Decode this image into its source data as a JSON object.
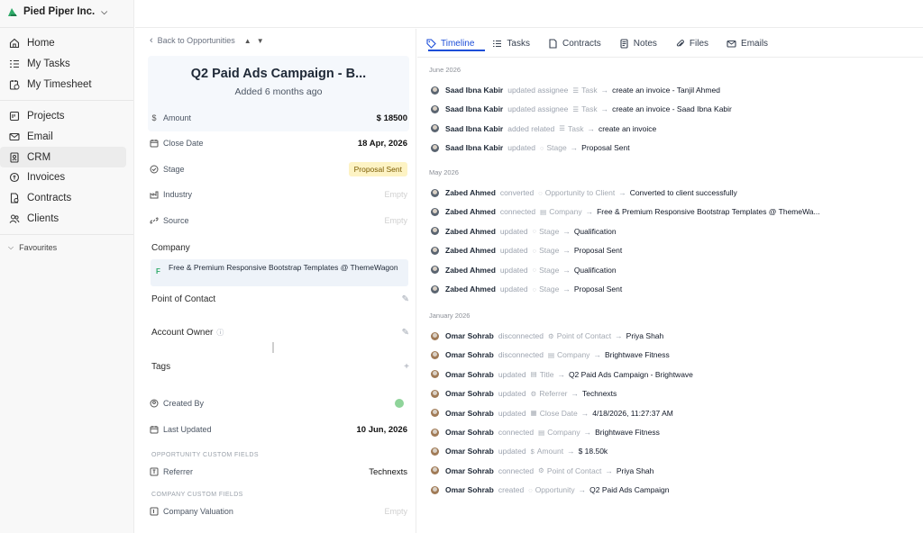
{
  "workspace": {
    "name": "Pied Piper Inc."
  },
  "sidebar": {
    "group1": [
      {
        "label": "Home",
        "icon": "home-icon"
      },
      {
        "label": "My Tasks",
        "icon": "tasks-icon"
      },
      {
        "label": "My Timesheet",
        "icon": "timesheet-icon"
      }
    ],
    "group2": [
      {
        "label": "Projects",
        "icon": "projects-icon"
      },
      {
        "label": "Email",
        "icon": "mail-icon"
      },
      {
        "label": "CRM",
        "icon": "crm-icon",
        "active": true
      },
      {
        "label": "Invoices",
        "icon": "invoice-icon"
      },
      {
        "label": "Contracts",
        "icon": "contract-icon"
      },
      {
        "label": "Clients",
        "icon": "clients-icon"
      }
    ],
    "favourites": "Favourites"
  },
  "detail": {
    "back_label": "Back to Opportunities",
    "title": "Q2 Paid Ads Campaign - B...",
    "subtitle": "Added 6 months ago",
    "amount": {
      "label": "Amount",
      "value": "$ 18500"
    },
    "close_date": {
      "label": "Close Date",
      "value": "18 Apr, 2026"
    },
    "stage": {
      "label": "Stage",
      "value": "Proposal Sent"
    },
    "industry": {
      "label": "Industry",
      "value": "Empty"
    },
    "source": {
      "label": "Source",
      "value": "Empty"
    },
    "company_label": "Company",
    "company_initial": "F",
    "company_name": "Free & Premium Responsive Bootstrap Templates @ ThemeWagon",
    "point_of_contact": "Point of Contact",
    "account_owner": "Account Owner",
    "tags": "Tags",
    "created_by": "Created By",
    "last_updated": {
      "label": "Last Updated",
      "value": "10 Jun, 2026"
    },
    "opportunity_custom_fields": "OPPORTUNITY CUSTOM FIELDS",
    "referrer": {
      "label": "Referrer",
      "value": "Technexts"
    },
    "company_custom_fields": "COMPANY CUSTOM FIELDS",
    "company_valuation": {
      "label": "Company Valuation",
      "value": "Empty"
    }
  },
  "tabs": [
    {
      "label": "Timeline",
      "icon": "tag-icon",
      "active": true
    },
    {
      "label": "Tasks",
      "icon": "list-icon"
    },
    {
      "label": "Contracts",
      "icon": "file-icon"
    },
    {
      "label": "Notes",
      "icon": "note-icon"
    },
    {
      "label": "Files",
      "icon": "paperclip-icon"
    },
    {
      "label": "Emails",
      "icon": "mail-icon"
    }
  ],
  "timeline_groups": [
    {
      "label": "June 2026",
      "events": [
        {
          "who": "Saad Ibna Kabir",
          "action": "updated assignee",
          "entity_icon": "list-icon",
          "entity": "Task",
          "result": "create an invoice - Tanjil Ahmed"
        },
        {
          "who": "Saad Ibna Kabir",
          "action": "updated assignee",
          "entity_icon": "list-icon",
          "entity": "Task",
          "result": "create an invoice - Saad Ibna Kabir"
        },
        {
          "who": "Saad Ibna Kabir",
          "action": "added related",
          "entity_icon": "list-icon",
          "entity": "Task",
          "result": "create an invoice"
        },
        {
          "who": "Saad Ibna Kabir",
          "action": "updated",
          "entity_icon": "stage-icon",
          "entity": "Stage",
          "result": "Proposal Sent"
        }
      ]
    },
    {
      "label": "May 2026",
      "events": [
        {
          "who": "Zabed Ahmed",
          "action": "converted",
          "entity_icon": "stage-icon",
          "entity": "Opportunity to Client",
          "result": "Converted to client successfully"
        },
        {
          "who": "Zabed Ahmed",
          "action": "connected",
          "entity_icon": "company-icon",
          "entity": "Company",
          "result": "Free & Premium Responsive Bootstrap Templates @ ThemeWa..."
        },
        {
          "who": "Zabed Ahmed",
          "action": "updated",
          "entity_icon": "stage-icon",
          "entity": "Stage",
          "result": "Qualification"
        },
        {
          "who": "Zabed Ahmed",
          "action": "updated",
          "entity_icon": "stage-icon",
          "entity": "Stage",
          "result": "Proposal Sent"
        },
        {
          "who": "Zabed Ahmed",
          "action": "updated",
          "entity_icon": "stage-icon",
          "entity": "Stage",
          "result": "Qualification"
        },
        {
          "who": "Zabed Ahmed",
          "action": "updated",
          "entity_icon": "stage-icon",
          "entity": "Stage",
          "result": "Proposal Sent"
        }
      ]
    },
    {
      "label": "January 2026",
      "events": [
        {
          "who": "Omar Sohrab",
          "action": "disconnected",
          "entity_icon": "contact-icon",
          "entity": "Point of Contact",
          "result": "Priya Shah"
        },
        {
          "who": "Omar Sohrab",
          "action": "disconnected",
          "entity_icon": "company-icon",
          "entity": "Company",
          "result": "Brightwave Fitness"
        },
        {
          "who": "Omar Sohrab",
          "action": "updated",
          "entity_icon": "title-icon",
          "entity": "Title",
          "result": "Q2 Paid Ads Campaign - Brightwave"
        },
        {
          "who": "Omar Sohrab",
          "action": "updated",
          "entity_icon": "referrer-icon",
          "entity": "Referrer",
          "result": "Technexts"
        },
        {
          "who": "Omar Sohrab",
          "action": "updated",
          "entity_icon": "calendar-icon",
          "entity": "Close Date",
          "result": "4/18/2026, 11:27:37 AM"
        },
        {
          "who": "Omar Sohrab",
          "action": "connected",
          "entity_icon": "company-icon",
          "entity": "Company",
          "result": "Brightwave Fitness"
        },
        {
          "who": "Omar Sohrab",
          "action": "updated",
          "entity_icon": "dollar-icon",
          "entity": "Amount",
          "result": "$ 18.50k"
        },
        {
          "who": "Omar Sohrab",
          "action": "connected",
          "entity_icon": "contact-icon",
          "entity": "Point of Contact",
          "result": "Priya Shah"
        },
        {
          "who": "Omar Sohrab",
          "action": "created",
          "entity_icon": "stage-icon",
          "entity": "Opportunity",
          "result": "Q2 Paid Ads Campaign"
        }
      ]
    }
  ]
}
